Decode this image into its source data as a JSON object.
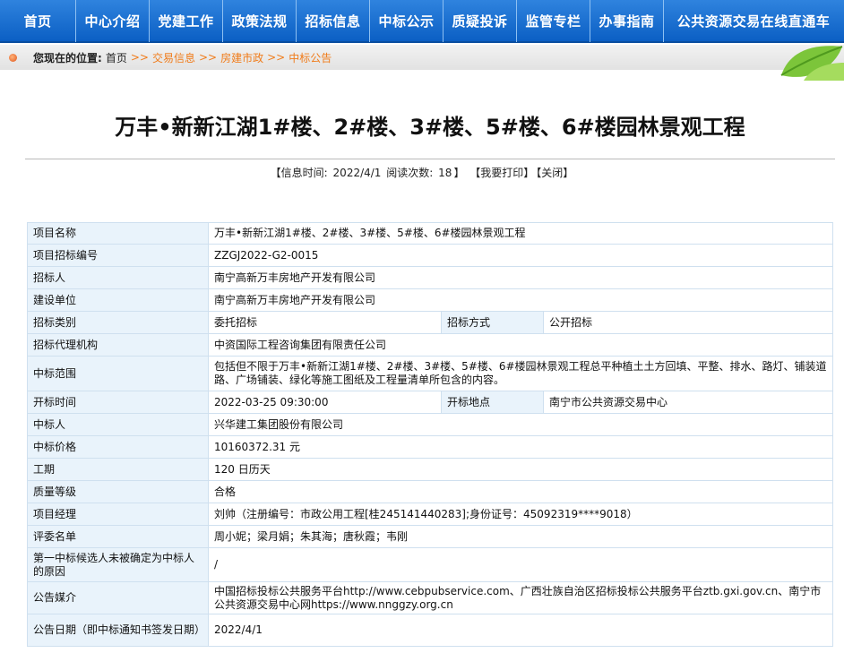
{
  "nav": {
    "items": [
      "首页",
      "中心介绍",
      "党建工作",
      "政策法规",
      "招标信息",
      "中标公示",
      "质疑投诉",
      "监管专栏",
      "办事指南",
      "公共资源交易在线直通车"
    ]
  },
  "breadcrumb": {
    "lead": "您现在的位置:",
    "home": "首页",
    "sep": ">>",
    "items": [
      "交易信息",
      "房建市政",
      "中标公告"
    ]
  },
  "title": "万丰•新新江湖1#楼、2#楼、3#楼、5#楼、6#楼园林景观工程",
  "meta": {
    "info_time_label": "【信息时间:",
    "info_time": "2022/4/1",
    "read_label": "阅读次数:",
    "read_count": "18",
    "close_bracket": "】",
    "print_label": "【我要打印】",
    "close_label": "【关闭】"
  },
  "table": {
    "project_name": {
      "label": "项目名称",
      "value": "万丰•新新江湖1#楼、2#楼、3#楼、5#楼、6#楼园林景观工程"
    },
    "project_code": {
      "label": "项目招标编号",
      "value": "ZZGJ2022-G2-0015"
    },
    "tenderer": {
      "label": "招标人",
      "value": "南宁高新万丰房地产开发有限公司"
    },
    "builder": {
      "label": "建设单位",
      "value": "南宁高新万丰房地产开发有限公司"
    },
    "tender_type": {
      "label": "招标类别",
      "value": "委托招标",
      "label2": "招标方式",
      "value2": "公开招标"
    },
    "agency": {
      "label": "招标代理机构",
      "value": "中资国际工程咨询集团有限责任公司"
    },
    "scope": {
      "label": "中标范围",
      "value": "包括但不限于万丰•新新江湖1#楼、2#楼、3#楼、5#楼、6#楼园林景观工程总平种植土土方回填、平整、排水、路灯、铺装道路、广场铺装、绿化等施工图纸及工程量清单所包含的内容。"
    },
    "open_time": {
      "label": "开标时间",
      "value": "2022-03-25 09:30:00",
      "label2": "开标地点",
      "value2": "南宁市公共资源交易中心"
    },
    "winner": {
      "label": "中标人",
      "value": "兴华建工集团股份有限公司"
    },
    "price": {
      "label": "中标价格",
      "value": "10160372.31 元"
    },
    "period": {
      "label": "工期",
      "value": "120 日历天"
    },
    "quality": {
      "label": "质量等级",
      "value": "合格"
    },
    "manager": {
      "label": "项目经理",
      "value": "刘帅（注册编号：市政公用工程[桂245141440283];身份证号：45092319****9018）"
    },
    "committee": {
      "label": "评委名单",
      "value": "周小妮；梁月娟；朱其海；唐秋霞；韦刚"
    },
    "first_reason": {
      "label": "第一中标候选人未被确定为中标人的原因",
      "value": "/"
    },
    "media": {
      "label": "公告媒介",
      "value": "中国招标投标公共服务平台http://www.cebpubservice.com、广西壮族自治区招标投标公共服务平台ztb.gxi.gov.cn、南宁市公共资源交易中心网https://www.nnggzy.org.cn"
    },
    "notice_date": {
      "label": "公告日期（即中标通知书签发日期）",
      "value": "2022/4/1"
    }
  },
  "colors": {
    "nav": "#0b5fc4",
    "link": "#f07c1b",
    "label_bg": "#e9f3fb",
    "border": "#cfe0ef"
  }
}
